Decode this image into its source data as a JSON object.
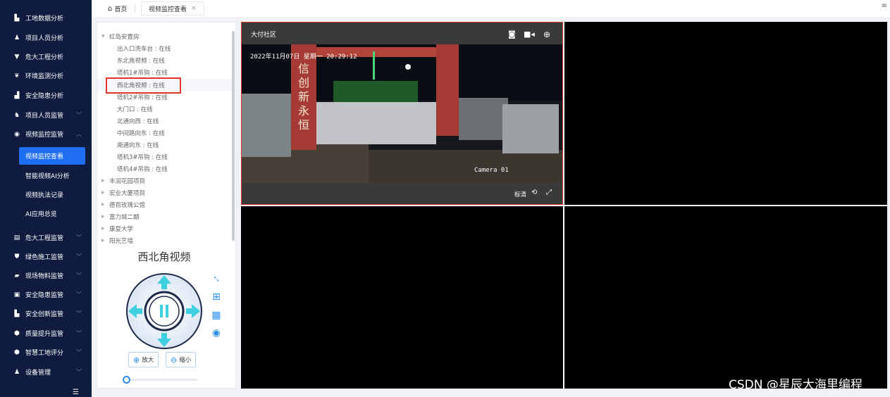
{
  "sidebar": {
    "items": [
      {
        "label": "工地数据分析",
        "icon": "building-icon"
      },
      {
        "label": "项目人员分析",
        "icon": "user-icon"
      },
      {
        "label": "危大工程分析",
        "icon": "filter-icon"
      },
      {
        "label": "环境监测分析",
        "icon": "leaf-icon"
      },
      {
        "label": "安全隐患分析",
        "icon": "bar-chart-icon"
      },
      {
        "label": "项目人员监管",
        "icon": "users-icon"
      },
      {
        "label": "视频监控监管",
        "icon": "camera-icon"
      },
      {
        "label": "危大工程监管",
        "icon": "briefcase-icon"
      },
      {
        "label": "绿色施工监管",
        "icon": "shield-icon"
      },
      {
        "label": "现场物料监管",
        "icon": "truck-icon"
      },
      {
        "label": "安全隐患监管",
        "icon": "clipboard-icon"
      },
      {
        "label": "安全创新监管",
        "icon": "building-icon"
      },
      {
        "label": "质量提升监管",
        "icon": "badge-icon"
      },
      {
        "label": "智慧工地评分",
        "icon": "star-icon"
      },
      {
        "label": "设备管理",
        "icon": "person-icon"
      }
    ],
    "video_sub": [
      "视频监控查看",
      "智能视频AI分析",
      "视频执法记录",
      "AI应用总览"
    ],
    "arrow_down": "﹀",
    "arrow_up": "︿"
  },
  "tabs": {
    "home": "首页",
    "video": "视频监控查看",
    "close": "×"
  },
  "tree": {
    "root": "红岛安置房",
    "children": [
      "出入口洗车台 : 在线",
      "东北角视频 : 在线",
      "塔机1#吊钩 : 在线",
      "西北角视频 : 在线",
      "塔机2#吊钩 : 在线",
      "大门口 : 在线",
      "北通向西 : 在线",
      "中间路向东 : 在线",
      "南通向东 : 在线",
      "塔机3#吊钩 : 在线",
      "塔机4#吊钩 : 在线"
    ],
    "projects": [
      "丰润花园项目",
      "宏业大厦项目",
      "德百玫瑰公馆",
      "富力城二期",
      "康复大学",
      "阳光艺墙"
    ]
  },
  "ptz": {
    "title": "西北角视频",
    "zoom_in": "放大",
    "zoom_out": "缩小"
  },
  "video": {
    "cell_title": "大付社区",
    "timestamp": "2022年11月07日 星期一 20:29:12",
    "camera_label": "Camera 01",
    "hd": "标清"
  },
  "watermark": "CSDN @星辰大海里编程",
  "colors": {
    "sidebar_bg": "#0f1c3f",
    "accent": "#1e6ef4",
    "ptz_cyan": "#3fd0e0",
    "highlight_red": "#e0342d"
  }
}
